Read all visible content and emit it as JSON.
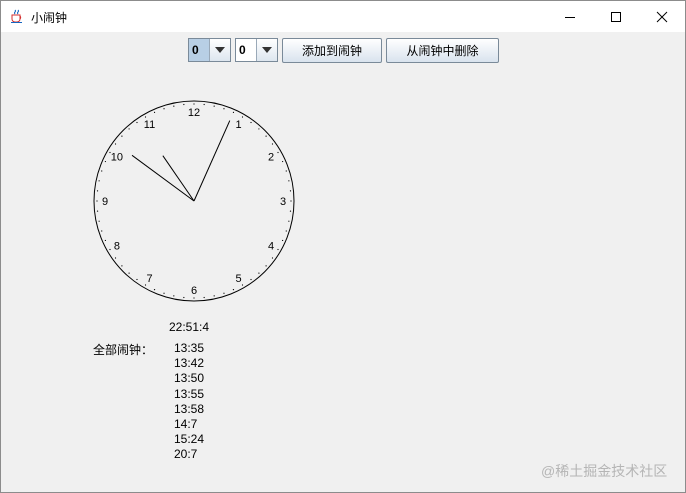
{
  "window": {
    "title": "小闹钟"
  },
  "controls": {
    "hour_value": "0",
    "minute_value": "0",
    "add_label": "添加到闹钟",
    "remove_label": "从闹钟中删除"
  },
  "clock": {
    "numbers": [
      "12",
      "1",
      "2",
      "3",
      "4",
      "5",
      "6",
      "7",
      "8",
      "9",
      "10",
      "11"
    ],
    "time": {
      "hour": 22,
      "minute": 51,
      "second": 4
    }
  },
  "current_time": "22:51:4",
  "alarms": {
    "label": "全部闹钟：",
    "items": [
      "13:35",
      "13:42",
      "13:50",
      "13:55",
      "13:58",
      "14:7",
      "15:24",
      "20:7"
    ]
  },
  "watermark": "@稀土掘金技术社区",
  "icons": {
    "app": "java-coffee-cup-icon",
    "minimize": "minimize-icon",
    "maximize": "maximize-icon",
    "close": "close-icon",
    "dropdown": "chevron-down-icon"
  }
}
